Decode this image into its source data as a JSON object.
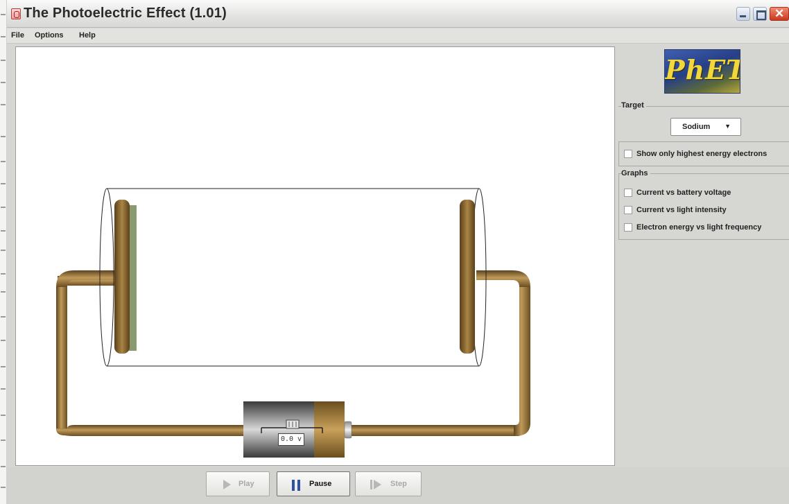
{
  "window": {
    "title": "The Photoelectric Effect (1.01)"
  },
  "menu": [
    "File",
    "Options",
    "Help"
  ],
  "sim": {
    "battery_voltage": "0.0 v"
  },
  "panel": {
    "logo_text": "PhET",
    "target_label": "Target",
    "target_value": "Sodium",
    "show_highest_label": "Show only highest energy electrons",
    "show_highest_checked": false,
    "graphs_label": "Graphs",
    "graphs": [
      {
        "label": "Current vs battery voltage",
        "checked": false
      },
      {
        "label": "Current vs light intensity",
        "checked": false
      },
      {
        "label": "Electron energy vs light frequency",
        "checked": false
      }
    ]
  },
  "controls": {
    "play": {
      "label": "Play",
      "enabled": false
    },
    "pause": {
      "label": "Pause",
      "enabled": true
    },
    "step": {
      "label": "Step",
      "enabled": false
    }
  },
  "colors": {
    "wire": "#8a6a32",
    "plate": "#7a5a2a",
    "target_coating": "#8a9a70",
    "logo_text": "#f2d73a"
  }
}
